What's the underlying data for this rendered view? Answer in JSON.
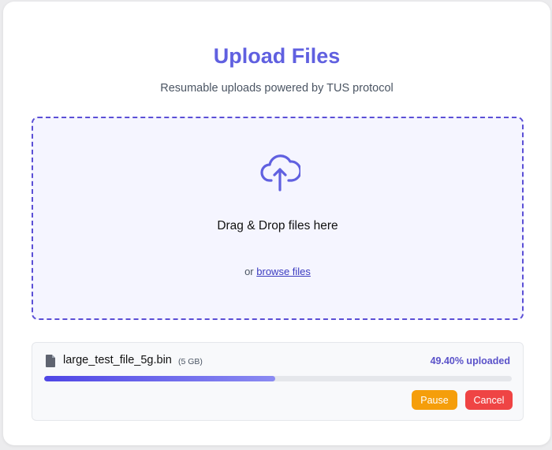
{
  "header": {
    "title": "Upload Files",
    "subtitle": "Resumable uploads powered by TUS protocol"
  },
  "dropzone": {
    "icon": "cloud-upload-icon",
    "drag_text": "Drag & Drop files here",
    "or_text": "or",
    "browse_label": "browse files"
  },
  "upload": {
    "file_icon": "file-icon",
    "file_name": "large_test_file_5g.bin",
    "file_size": "(5 GB)",
    "progress_text": "49.40% uploaded",
    "progress_fraction": 0.494,
    "pause_label": "Pause",
    "cancel_label": "Cancel"
  },
  "colors": {
    "accent": "#6060e0",
    "dropzone_border": "#5b4fd6",
    "pause": "#f59e0b",
    "cancel": "#ef4444"
  }
}
